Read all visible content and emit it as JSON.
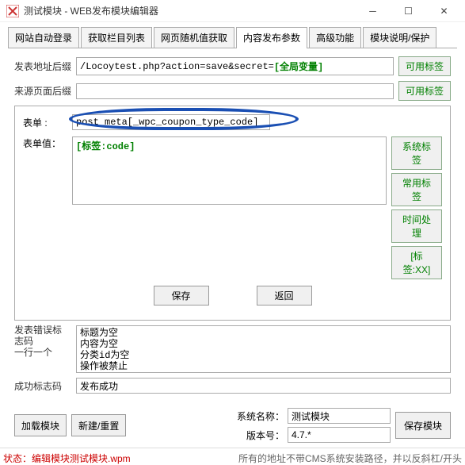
{
  "window": {
    "title": "测试模块 - WEB发布模块编辑器"
  },
  "tabs": [
    "网站自动登录",
    "获取栏目列表",
    "网页随机值获取",
    "内容发布参数",
    "高级功能",
    "模块说明/保护"
  ],
  "activeTab": 3,
  "publish": {
    "addrSuffixLabel": "发表地址后缀",
    "addrSuffixValue": "/Locoytest.php?action=save&secret=",
    "addrSuffixVar": "[全局变量]",
    "refSuffixLabel": "来源页面后缀",
    "refSuffixValue": "",
    "tagBtn": "可用标签"
  },
  "form": {
    "nameLabel": "表单   :",
    "nameValue": "post_meta[_wpc_coupon_type_code]",
    "valueLabel": "表单值：",
    "valueContent": "[标签:code]",
    "sideBtns": [
      "系统标签",
      "常用标签",
      "时间处理",
      "[标签:XX]"
    ],
    "saveBtn": "保存",
    "backBtn": "返回"
  },
  "err": {
    "label": "发表错误标\n志码\n一行一个",
    "value": "标题为空\n内容为空\n分类id为空\n操作被禁止"
  },
  "succ": {
    "label": "成功标志码",
    "value": "发布成功"
  },
  "footer": {
    "loadBtn": "加载模块",
    "newBtn": "新建/重置",
    "sysNameLabel": "系统名称：",
    "sysNameValue": "测试模块",
    "verLabel": "版本号：",
    "verValue": "4.7.*",
    "saveModBtn": "保存模块"
  },
  "status": {
    "left": "状态：编辑模块测试模块.wpm",
    "right": "所有的地址不带CMS系统安装路径，并以反斜杠/开头"
  }
}
